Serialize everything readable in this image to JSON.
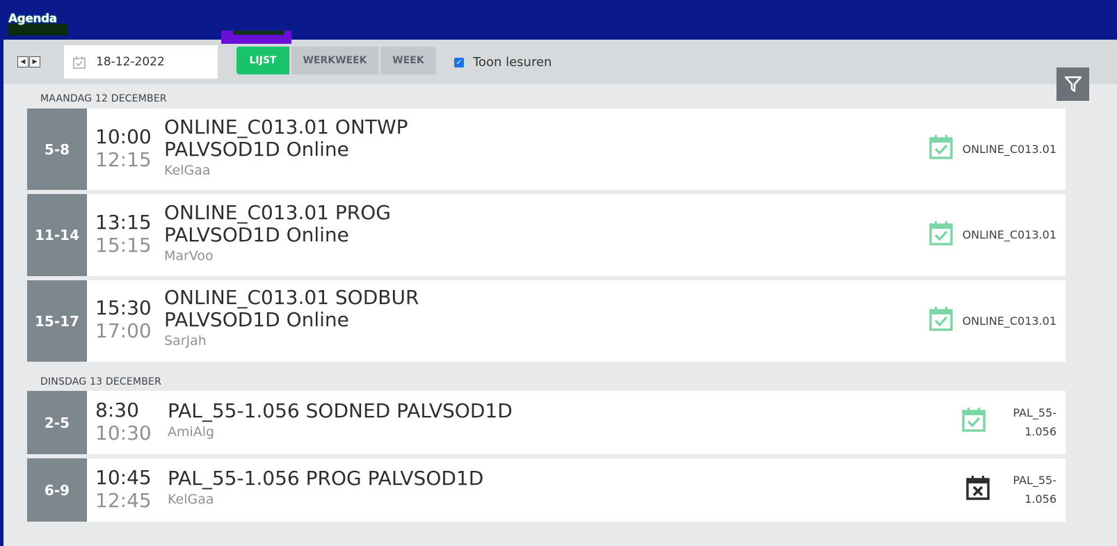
{
  "app": {
    "title": "Agenda"
  },
  "toolbar": {
    "date_value": "18-12-2022",
    "tabs": [
      "LIJST",
      "WERKWEEK",
      "WEEK"
    ],
    "active_tab": "LIJST",
    "toggle_label": "Toon lesuren",
    "toggle_checked": true
  },
  "colors": {
    "header": "#0a1a8c",
    "active_tab": "#18c36a",
    "present_icon": "#7dd6a6",
    "absent_icon": "#2b2f33"
  },
  "days": [
    {
      "header": "MAANDAG 12 DECEMBER",
      "lessons": [
        {
          "period": "5-8",
          "start": "10:00",
          "end": "12:15",
          "title_line1": "ONLINE_C013.01 ONTWP",
          "title_line2": "PALVSOD1D Online",
          "teacher": "KelGaa",
          "status_icon": "calendar-check-icon",
          "room": "ONLINE_C013.01"
        },
        {
          "period": "11-14",
          "start": "13:15",
          "end": "15:15",
          "title_line1": "ONLINE_C013.01 PROG",
          "title_line2": "PALVSOD1D Online",
          "teacher": "MarVoo",
          "status_icon": "calendar-check-icon",
          "room": "ONLINE_C013.01"
        },
        {
          "period": "15-17",
          "start": "15:30",
          "end": "17:00",
          "title_line1": "ONLINE_C013.01 SODBUR",
          "title_line2": "PALVSOD1D Online",
          "teacher": "SarJah",
          "status_icon": "calendar-check-icon",
          "room": "ONLINE_C013.01"
        }
      ]
    },
    {
      "header": "DINSDAG 13 DECEMBER",
      "lessons": [
        {
          "period": "2-5",
          "start": "8:30",
          "end": "10:30",
          "title_line1": "PAL_55-1.056 SODNED PALVSOD1D",
          "teacher": "AmiAlg",
          "status_icon": "calendar-check-icon",
          "room_line1": "PAL_55-",
          "room_line2": "1.056"
        },
        {
          "period": "6-9",
          "start": "10:45",
          "end": "12:45",
          "title_line1": "PAL_55-1.056 PROG PALVSOD1D",
          "teacher": "KelGaa",
          "status_icon": "calendar-x-icon",
          "room_line1": "PAL_55-",
          "room_line2": "1.056"
        }
      ]
    }
  ]
}
